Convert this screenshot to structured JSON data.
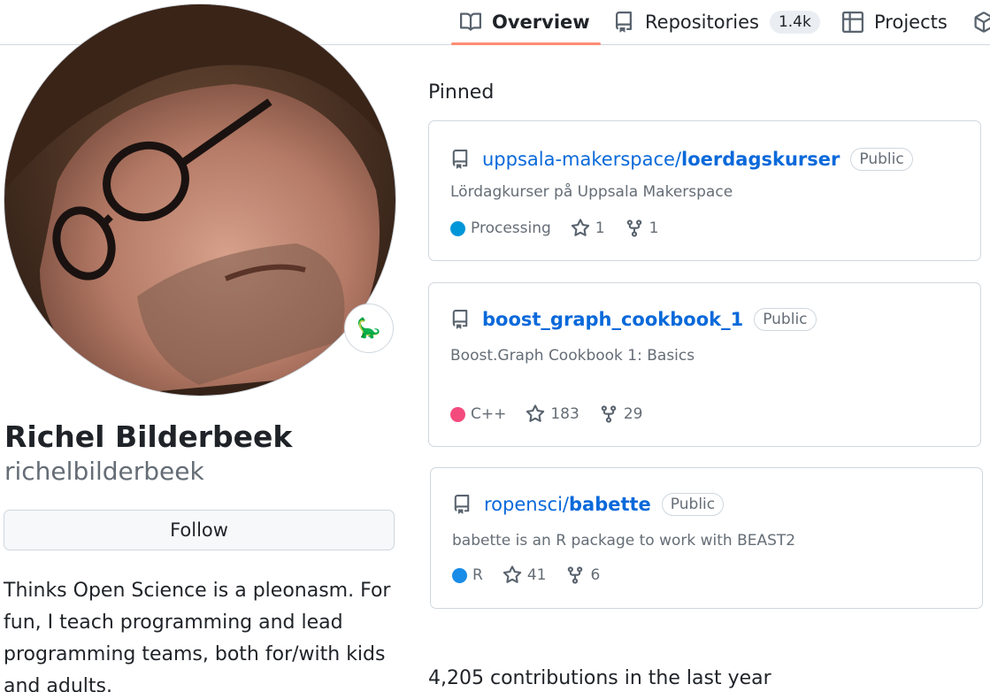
{
  "tabs": [
    {
      "label": "Overview",
      "icon": "book-icon",
      "selected": true
    },
    {
      "label": "Repositories",
      "icon": "repo-icon",
      "count": "1.4k"
    },
    {
      "label": "Projects",
      "icon": "table-icon"
    }
  ],
  "profile": {
    "name": "Richel Bilderbeek",
    "login": "richelbilderbeek",
    "status_emoji": "🦕",
    "follow_label": "Follow",
    "bio": "Thinks Open Science is a pleonasm. For fun, I teach programming and lead programming teams, both for/with kids and adults."
  },
  "pinned": {
    "title": "Pinned",
    "items": [
      {
        "owner": "uppsala-makerspace/",
        "repo": "loerdagskurser",
        "visibility": "Public",
        "description": "Lördagkurser på Uppsala Makerspace",
        "language": "Processing",
        "language_color": "#0096d8",
        "stars": "1",
        "forks": "1"
      },
      {
        "owner": "",
        "repo": "boost_graph_cookbook_1",
        "visibility": "Public",
        "description": "Boost.Graph Cookbook 1: Basics",
        "language": "C++",
        "language_color": "#f34b7d",
        "stars": "183",
        "forks": "29"
      },
      {
        "owner": "ropensci/",
        "repo": "babette",
        "visibility": "Public",
        "description": "babette is an R package to work with BEAST2",
        "language": "R",
        "language_color": "#198ce7",
        "stars": "41",
        "forks": "6"
      }
    ]
  },
  "contributions": {
    "summary": "4,205 contributions in the last year"
  }
}
